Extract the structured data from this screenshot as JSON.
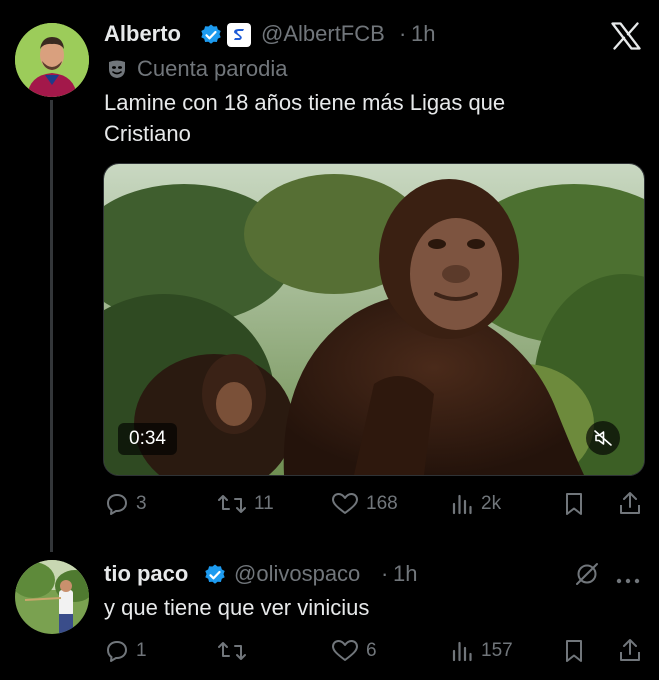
{
  "tweet": {
    "author_name": "Alberto",
    "handle": "@AlbertFCB",
    "separator": "·",
    "time": "1h",
    "parody_label": "Cuenta parodia",
    "text_line1": "Lamine con 18 años tiene más Ligas que",
    "text_line2": "Cristiano",
    "video_duration": "0:34",
    "replies": "3",
    "retweets": "11",
    "likes": "168",
    "views": "2k"
  },
  "reply": {
    "author_name": "tio paco",
    "handle": "@olivospaco",
    "separator": "·",
    "time": "1h",
    "text": "y que tiene que ver vinicius",
    "replies": "1",
    "retweets": "",
    "likes": "6",
    "views": "157"
  },
  "colors": {
    "background": "#000000",
    "verified": "#1d9bf0",
    "secondary_text": "#71767b",
    "primary_text": "#e7e9ea"
  }
}
